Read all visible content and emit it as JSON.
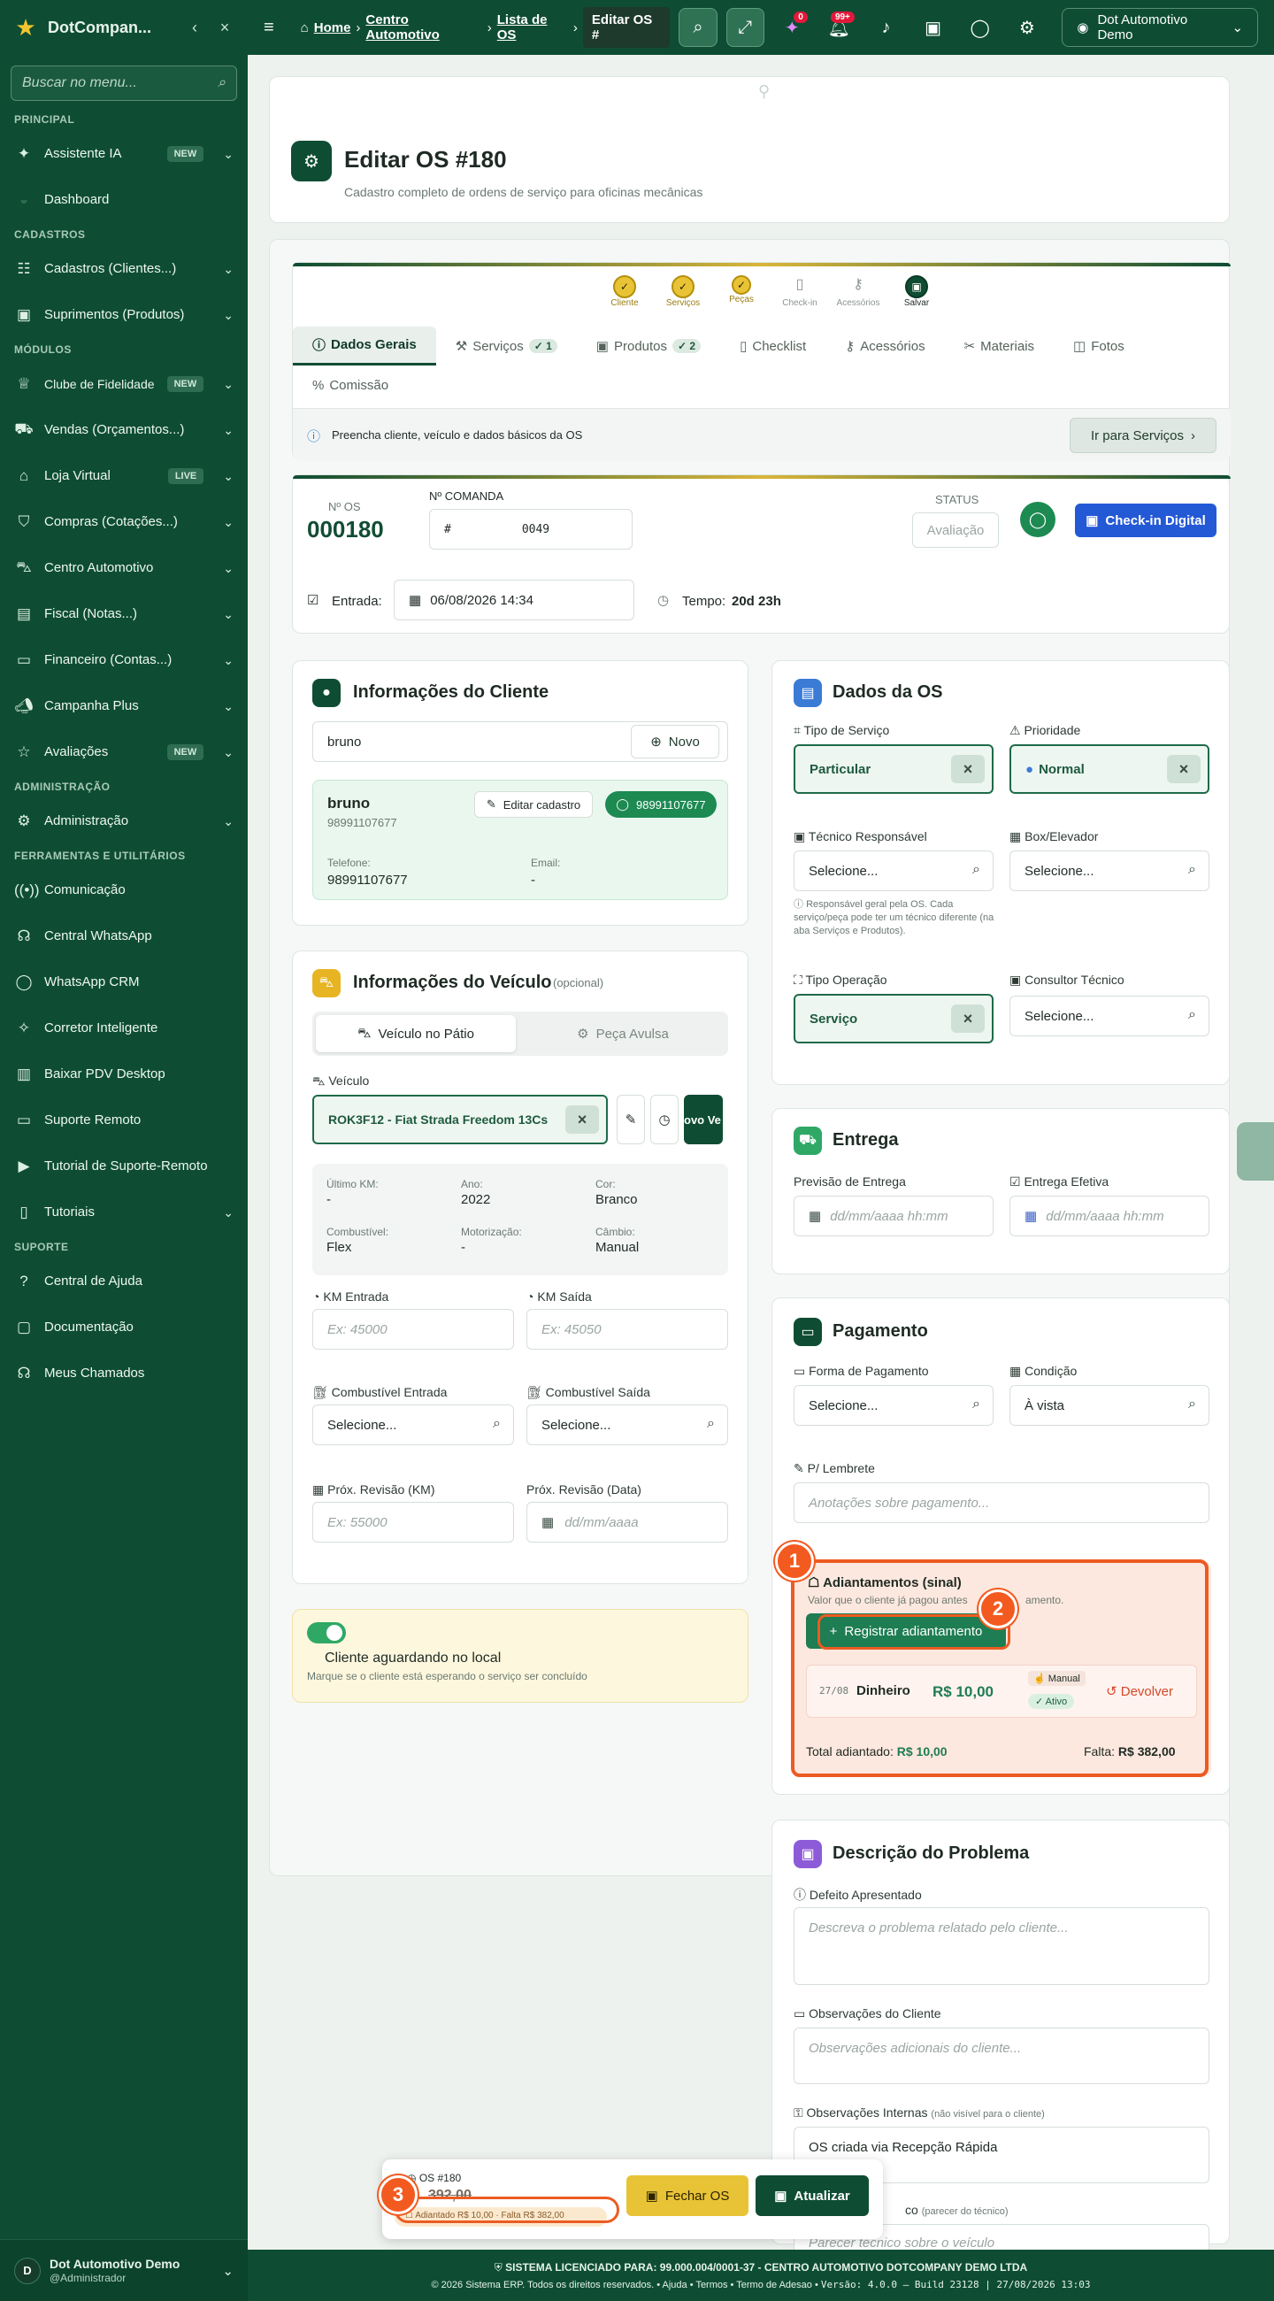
{
  "sidebar": {
    "brand": "DotCompan...",
    "search_placeholder": "Buscar no menu...",
    "sections": {
      "principal": "PRINCIPAL",
      "cadastros": "CADASTROS",
      "modulos": "MÓDULOS",
      "admin": "ADMINISTRAÇÃO",
      "ferramentas": "FERRAMENTAS E UTILITÁRIOS",
      "suporte": "SUPORTE"
    },
    "items": {
      "assistente": "Assistente IA",
      "dashboard": "Dashboard",
      "cadastros": "Cadastros (Clientes...)",
      "suprimentos": "Suprimentos (Produtos)",
      "clube": "Clube de Fidelidade",
      "vendas": "Vendas (Orçamentos...)",
      "loja": "Loja Virtual",
      "compras": "Compras (Cotações...)",
      "centro": "Centro Automotivo",
      "fiscal": "Fiscal (Notas...)",
      "financeiro": "Financeiro (Contas...)",
      "campanha": "Campanha Plus",
      "avaliacoes": "Avaliações",
      "administracao": "Administração",
      "comunicacao": "Comunicação",
      "central_whatsapp": "Central WhatsApp",
      "whatsapp_crm": "WhatsApp CRM",
      "corretor": "Corretor Inteligente",
      "baixar_pdv": "Baixar PDV Desktop",
      "suporte_remoto": "Suporte Remoto",
      "tutorial_suporte": "Tutorial de Suporte-Remoto",
      "tutoriais": "Tutoriais",
      "central_ajuda": "Central de Ajuda",
      "documentacao": "Documentação",
      "meus_chamados": "Meus Chamados"
    },
    "badges": {
      "new": "NEW",
      "live": "LIVE"
    },
    "user": {
      "initial": "D",
      "name": "Dot Automotivo Demo",
      "role": "@Administrador"
    }
  },
  "topbar": {
    "breadcrumb": [
      "Home",
      "Centro Automotivo",
      "Lista de OS",
      "Editar OS #"
    ],
    "notif_ai": "0",
    "notif_bell": "99+",
    "user": "Dot Automotivo Demo"
  },
  "page": {
    "title": "Editar OS #180",
    "subtitle": "Cadastro completo de ordens de serviço para oficinas mecânicas"
  },
  "steps": [
    "Cliente",
    "Serviços",
    "Peças",
    "Check-in",
    "Acessórios",
    "Salvar"
  ],
  "tabs": {
    "dados": "Dados Gerais",
    "servicos": "Serviços",
    "servicos_count": "1",
    "produtos": "Produtos",
    "produtos_count": "2",
    "checklist": "Checklist",
    "acessorios": "Acessórios",
    "materiais": "Materiais",
    "fotos": "Fotos",
    "comissao": "Comissão"
  },
  "hint": {
    "text": "Preencha cliente, veículo e dados básicos da OS",
    "button": "Ir para Serviços"
  },
  "os": {
    "no_label": "Nº OS",
    "number": "000180",
    "comanda_label": "Nº COMANDA",
    "comanda_prefix": "#",
    "comanda_value": "0049",
    "status_label": "STATUS",
    "status": "Avaliação",
    "checkin": "Check-in Digital",
    "entrada_label": "Entrada:",
    "entrada": "06/08/2026 14:34",
    "tempo_label": "Tempo:",
    "tempo": "20d 23h"
  },
  "cliente": {
    "title": "Informações do Cliente",
    "search": "bruno",
    "novo": "Novo",
    "name": "bruno",
    "phone_small": "98991107677",
    "editar": "Editar cadastro",
    "whats": "98991107677",
    "tel_label": "Telefone:",
    "tel": "98991107677",
    "email_label": "Email:",
    "email": "-"
  },
  "veiculo": {
    "title": "Informações do Veículo",
    "opcional": "(opcional)",
    "tab1": "Veículo no Pátio",
    "tab2": "Peça Avulsa",
    "label": "Veículo",
    "value": "ROK3F12 - Fiat Strada Freedom 13Cs",
    "novo": "ovo Ve",
    "km_label": "Último KM:",
    "km": "-",
    "ano_label": "Ano:",
    "ano": "2022",
    "cor_label": "Cor:",
    "cor": "Branco",
    "comb_label": "Combustível:",
    "comb": "Flex",
    "motor_label": "Motorização:",
    "motor": "-",
    "cambio_label": "Câmbio:",
    "cambio": "Manual",
    "km_entrada": "KM Entrada",
    "km_entrada_ph": "Ex: 45000",
    "km_saida": "KM Saída",
    "km_saida_ph": "Ex: 45050",
    "comb_entrada": "Combustível Entrada",
    "comb_saida": "Combustível Saída",
    "selecione": "Selecione...",
    "prox_km": "Próx. Revisão (KM)",
    "prox_km_ph": "Ex: 55000",
    "prox_data": "Próx. Revisão (Data)",
    "prox_data_ph": "dd/mm/aaaa"
  },
  "aguardando": {
    "title": "Cliente aguardando no local",
    "desc": "Marque se o cliente está esperando o serviço ser concluído"
  },
  "dados_os": {
    "title": "Dados da OS",
    "tipo_label": "Tipo de Serviço",
    "tipo": "Particular",
    "prioridade_label": "Prioridade",
    "prioridade": "Normal",
    "tecnico_label": "Técnico Responsável",
    "box_label": "Box/Elevador",
    "selecione": "Selecione...",
    "tecnico_hint": "Responsável geral pela OS. Cada serviço/peça pode ter um técnico diferente (na aba Serviços e Produtos).",
    "operacao_label": "Tipo Operação",
    "operacao": "Serviço",
    "consultor_label": "Consultor Técnico"
  },
  "entrega": {
    "title": "Entrega",
    "previsao": "Previsão de Entrega",
    "efetiva": "Entrega Efetiva",
    "ph": "dd/mm/aaaa hh:mm"
  },
  "pagamento": {
    "title": "Pagamento",
    "forma_label": "Forma de Pagamento",
    "forma": "Selecione...",
    "condicao_label": "Condição",
    "condicao": "À vista",
    "lembrete_label": "P/ Lembrete",
    "lembrete_ph": "Anotações sobre pagamento...",
    "adiant_title": "Adiantamentos (sinal)",
    "adiant_desc": "Valor que o cliente já pagou antes",
    "adiant_desc2": "amento.",
    "registrar": "Registrar adiantamento",
    "row_date": "27/08",
    "row_method": "Dinheiro",
    "row_value": "R$ 10,00",
    "row_manual": "Manual",
    "row_status": "Ativo",
    "devolver": "Devolver",
    "total_label": "Total adiantado:",
    "total": "R$ 10,00",
    "falta_label": "Falta:",
    "falta": "R$ 382,00"
  },
  "descricao": {
    "title": "Descrição do Problema",
    "defeito": "Defeito Apresentado",
    "defeito_ph": "Descreva o problema relatado pelo cliente...",
    "obs_cliente": "Observações do Cliente",
    "obs_cliente_ph": "Observações adicionais do cliente...",
    "obs_internas": "Observações Internas",
    "obs_internas_note": "(não visível para o cliente)",
    "obs_internas_val": "OS criada via Recepção Rápida",
    "laudo_label": "co",
    "laudo_note": "(parecer do técnico)",
    "laudo_ph": "Parecer técnico sobre o veículo"
  },
  "floatbar": {
    "os": "OS #180",
    "total": "392,00",
    "adiant": "Adiantado R$ 10,00 · Falta R$ 382,00",
    "fechar": "Fechar OS",
    "atualizar": "Atualizar"
  },
  "callouts": [
    "1",
    "2",
    "3"
  ],
  "footer": {
    "line1": "SISTEMA LICENCIADO PARA: 99.000.004/0001-37 - CENTRO AUTOMOTIVO DOTCOMPANY DEMO LTDA",
    "copy": "© 2026 Sistema ERP. Todos os direitos reservados.",
    "ajuda": "Ajuda",
    "termos": "Termos",
    "adesao": "Termo de Adesao",
    "versao": "Versão: 4.0.0 – Build 23128 | 27/08/2026 13:03"
  },
  "colors": {
    "primary": "#0e4d34",
    "accent": "#f2c530",
    "highlight": "#ec5b22",
    "whatsapp": "#1d8a52",
    "checkin": "#2459d6"
  }
}
